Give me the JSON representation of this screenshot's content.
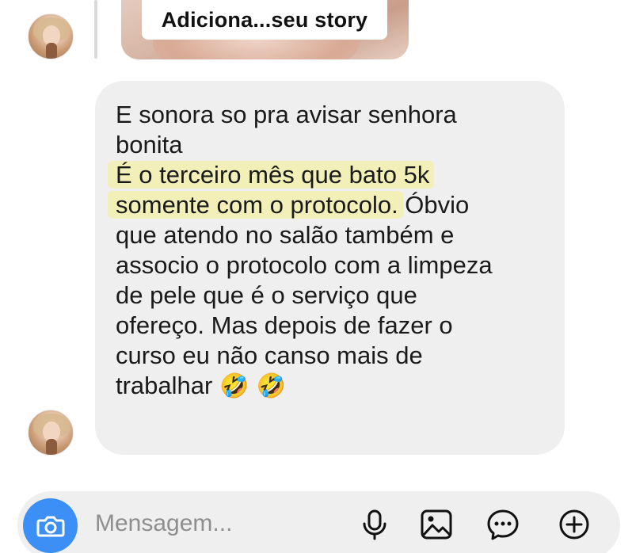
{
  "story_reply": {
    "label": "Adiciona...seu story"
  },
  "message": {
    "lines": [
      "E sonora so pra avisar senhora",
      "bonita",
      "É o terceiro mês que bato 5k",
      "somente com o protocolo.",
      " Óbvio",
      "que atendo no salão também e",
      "associo o protocolo com a limpeza",
      "de pele que é o serviço que",
      "ofereço. Mas depois de fazer o",
      "curso eu não canso mais de",
      "trabalhar"
    ],
    "emojis": "🤣 🤣",
    "highlight_color": "#f2f0b8",
    "bubble_color": "#efefef"
  },
  "composer": {
    "placeholder": "Mensagem...",
    "camera_color": "#3b8ff5",
    "icons": [
      "camera-icon",
      "microphone-icon",
      "gallery-icon",
      "sticker-icon",
      "plus-icon"
    ]
  }
}
